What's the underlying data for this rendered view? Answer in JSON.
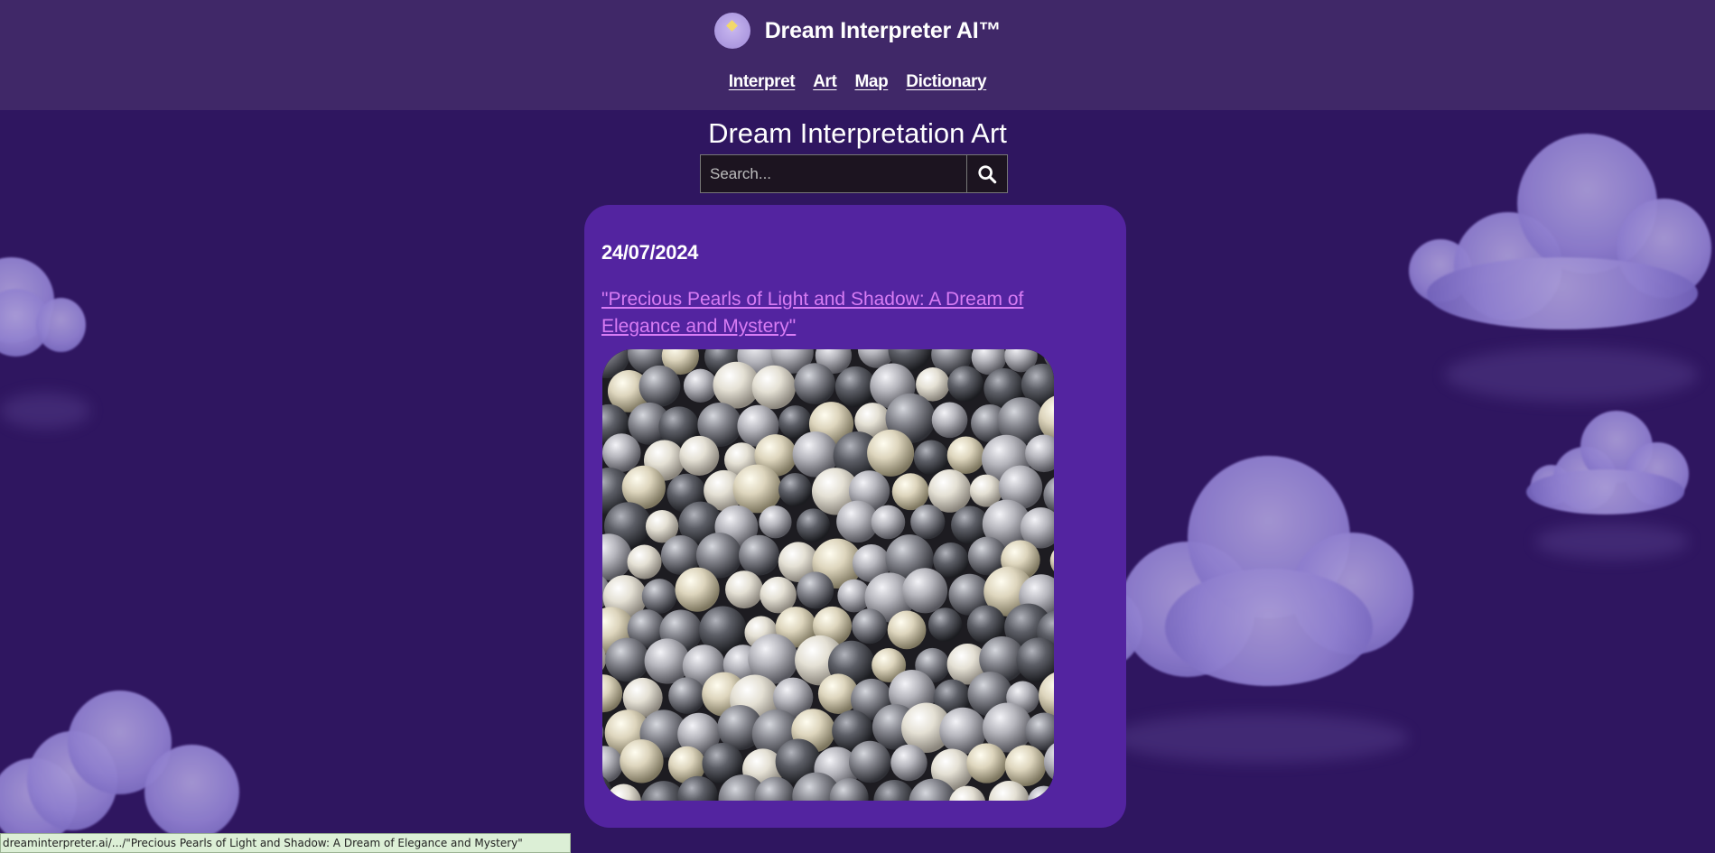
{
  "header": {
    "brand_name": "Dream Interpreter AI™",
    "logo_icon": "crystal-ball-icon",
    "nav": [
      {
        "label": "Interpret"
      },
      {
        "label": "Art"
      },
      {
        "label": "Map"
      },
      {
        "label": "Dictionary"
      }
    ]
  },
  "main": {
    "title": "Dream Interpretation Art",
    "search": {
      "placeholder": "Search...",
      "value": "",
      "button_icon": "search-icon"
    }
  },
  "card": {
    "date": "24/07/2024",
    "link_text": "\"Precious Pearls of Light and Shadow: A Dream of Elegance and Mystery\"",
    "image_alt": "pearls-image"
  },
  "status_bar": {
    "text": "dreaminterpreter.ai/.../\"Precious Pearls of Light and Shadow: A Dream of Elegance and Mystery\""
  },
  "colors": {
    "background": "#2f1660",
    "header": "#402868",
    "card": "#5324a0",
    "link": "#d87cf4"
  }
}
